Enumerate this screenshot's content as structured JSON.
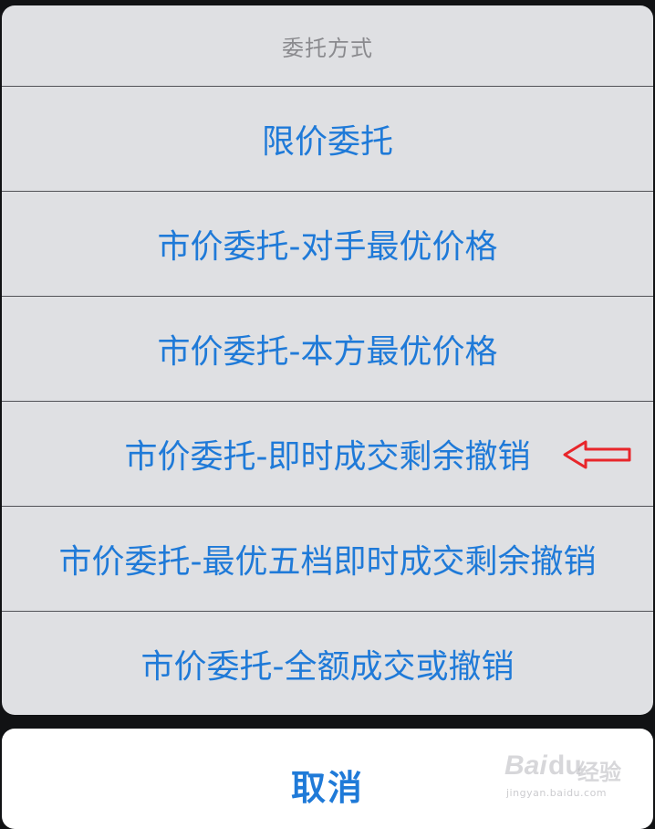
{
  "action_sheet": {
    "title": "委托方式",
    "options": [
      {
        "label": "限价委托"
      },
      {
        "label": "市价委托-对手最优价格"
      },
      {
        "label": "市价委托-本方最优价格"
      },
      {
        "label": "市价委托-即时成交剩余撤销"
      },
      {
        "label": "市价委托-最优五档即时成交剩余撤销"
      },
      {
        "label": "市价委托-全额成交或撤销"
      }
    ],
    "cancel_label": "取消"
  },
  "annotation": {
    "type": "arrow-left-icon",
    "color": "#e8262b",
    "points_to_option": 3
  },
  "watermark": {
    "bai": "Bai",
    "du": "du",
    "jingyan": "经验",
    "url": "jingyan.baidu.com"
  },
  "colors": {
    "option_text": "#1f7ad8",
    "title_text": "#8a8a8e",
    "sheet_bg": "#dfe0e3",
    "divider": "#515257",
    "backdrop": "#111214"
  }
}
